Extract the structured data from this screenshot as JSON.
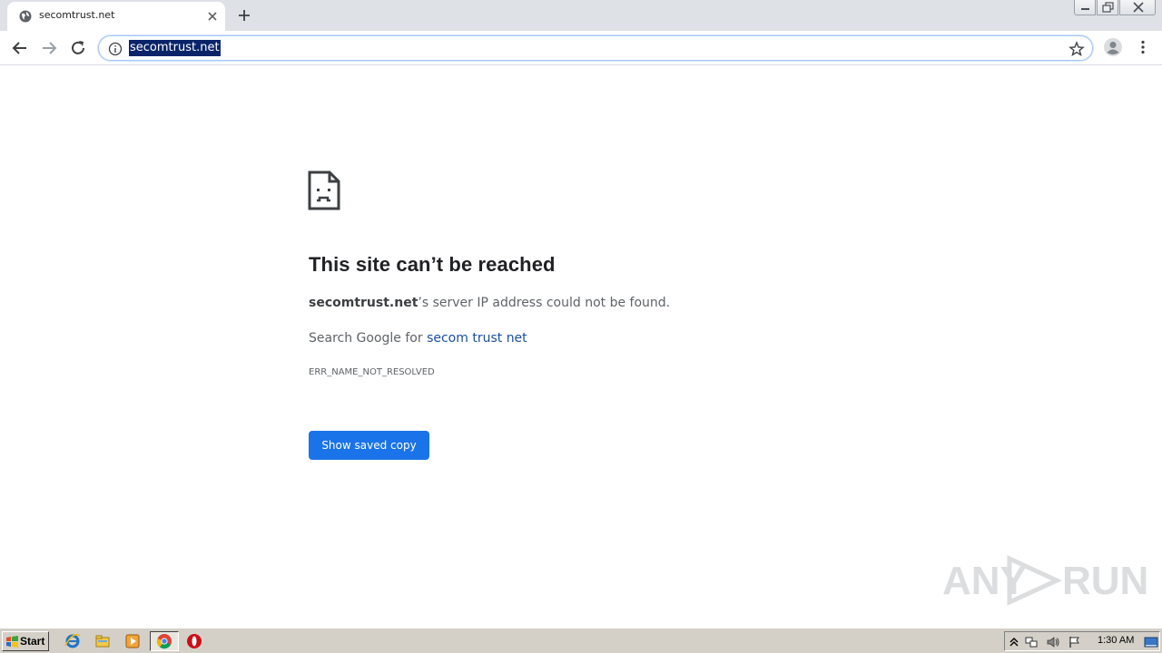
{
  "browser": {
    "tab": {
      "title": "secomtrust.net"
    },
    "address_bar": {
      "url": "secomtrust.net"
    }
  },
  "error_page": {
    "title": "This site can’t be reached",
    "message_host": "secomtrust.net",
    "message_rest": "’s server IP address could not be found.",
    "search_prefix": "Search Google for ",
    "search_link": "secom trust net",
    "error_code": "ERR_NAME_NOT_RESOLVED",
    "button_label": "Show saved copy",
    "button_color": "#1a73e8",
    "link_color": "#1a4fa0"
  },
  "watermark": {
    "left": "ANY",
    "right": "RUN"
  },
  "taskbar": {
    "start_label": "Start",
    "clock": "1:30 AM",
    "pinned": [
      "internet-explorer-icon",
      "file-explorer-icon",
      "media-player-icon",
      "chrome-icon",
      "opera-icon"
    ]
  }
}
